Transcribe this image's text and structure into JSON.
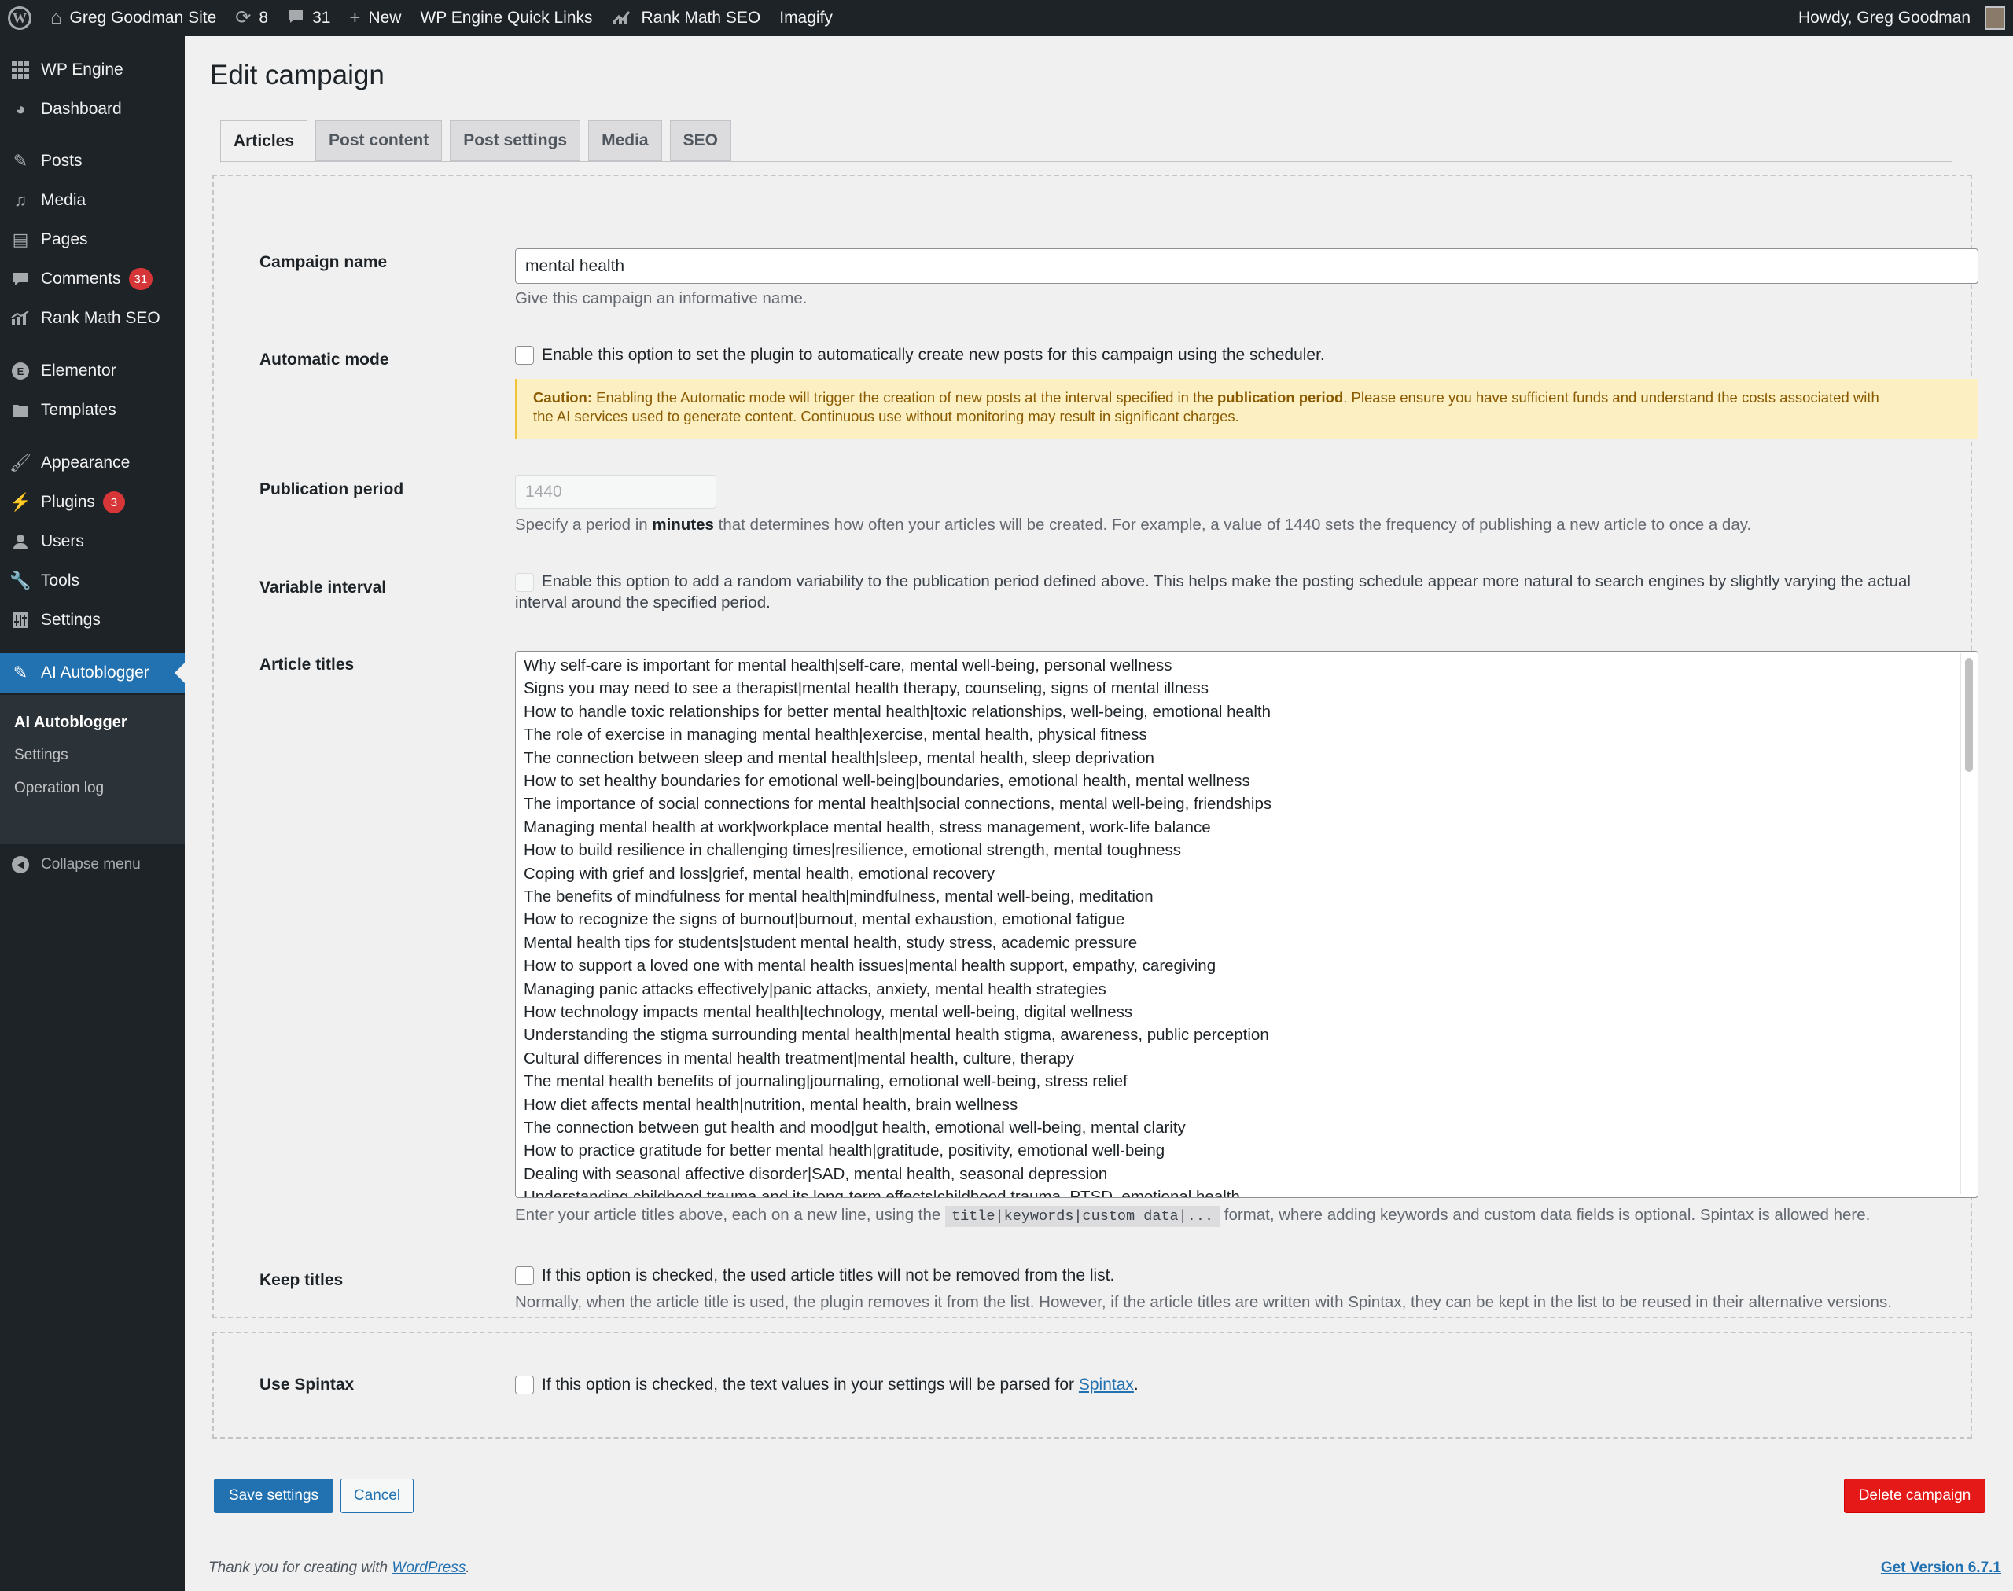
{
  "adminbar": {
    "site_name": "Greg Goodman Site",
    "updates_count": "8",
    "comments_count": "31",
    "new_label": "New",
    "quick_links_label": "WP Engine Quick Links",
    "rank_math_label": "Rank Math SEO",
    "imagify_label": "Imagify",
    "howdy": "Howdy, Greg Goodman"
  },
  "sidebar": {
    "items": [
      {
        "label": "WP Engine",
        "icon": "grid-icon"
      },
      {
        "label": "Dashboard",
        "icon": "dashboard-icon"
      },
      {
        "label": "Posts",
        "icon": "pin-icon"
      },
      {
        "label": "Media",
        "icon": "media-icon"
      },
      {
        "label": "Pages",
        "icon": "pages-icon"
      },
      {
        "label": "Comments",
        "icon": "comment-icon",
        "badge": "31"
      },
      {
        "label": "Rank Math SEO",
        "icon": "chart-icon"
      },
      {
        "label": "Elementor",
        "icon": "elementor-icon"
      },
      {
        "label": "Templates",
        "icon": "folder-icon"
      },
      {
        "label": "Appearance",
        "icon": "brush-icon"
      },
      {
        "label": "Plugins",
        "icon": "plug-icon",
        "badge": "3"
      },
      {
        "label": "Users",
        "icon": "user-icon"
      },
      {
        "label": "Tools",
        "icon": "wrench-icon"
      },
      {
        "label": "Settings",
        "icon": "settings-icon"
      },
      {
        "label": "AI Autoblogger",
        "icon": "pen-icon"
      }
    ],
    "submenu": [
      "AI Autoblogger",
      "Settings",
      "Operation log"
    ],
    "collapse_label": "Collapse menu"
  },
  "page": {
    "title": "Edit campaign",
    "tabs": [
      "Articles",
      "Post content",
      "Post settings",
      "Media",
      "SEO"
    ]
  },
  "form": {
    "campaign_name": {
      "label": "Campaign name",
      "value": "mental health",
      "description": "Give this campaign an informative name."
    },
    "automatic_mode": {
      "label": "Automatic mode",
      "checkbox_text": "Enable this option to set the plugin to automatically create new posts for this campaign using the scheduler.",
      "caution_label": "Caution:",
      "caution_text_1": "Enabling the Automatic mode will trigger the creation of new posts at the interval specified in the",
      "caution_strong": "publication period",
      "caution_text_2": ". Please ensure you have sufficient funds and understand the costs associated with",
      "caution_text_3": "the AI services used to generate content. Continuous use without monitoring may result in significant charges."
    },
    "publication_period": {
      "label": "Publication period",
      "value": "1440",
      "desc_1": "Specify a period in",
      "desc_strong": "minutes",
      "desc_2": "that determines how often your articles will be created. For example, a value of 1440 sets the frequency of publishing a new article to once a day."
    },
    "variable_interval": {
      "label": "Variable interval",
      "text_line_1": "Enable this option to add a random variability to the publication period defined above. This helps make the posting schedule appear more natural to search engines by slightly varying the actual",
      "text_line_2": "interval around the specified period."
    },
    "article_titles": {
      "label": "Article titles",
      "lines": [
        "Why self-care is important for mental health|self-care, mental well-being, personal wellness",
        "Signs you may need to see a therapist|mental health therapy, counseling, signs of mental illness",
        "How to handle toxic relationships for better mental health|toxic relationships, well-being, emotional health",
        "The role of exercise in managing mental health|exercise, mental health, physical fitness",
        "The connection between sleep and mental health|sleep, mental health, sleep deprivation",
        "How to set healthy boundaries for emotional well-being|boundaries, emotional health, mental wellness",
        "The importance of social connections for mental health|social connections, mental well-being, friendships",
        "Managing mental health at work|workplace mental health, stress management, work-life balance",
        "How to build resilience in challenging times|resilience, emotional strength, mental toughness",
        "Coping with grief and loss|grief, mental health, emotional recovery",
        "The benefits of mindfulness for mental health|mindfulness, mental well-being, meditation",
        "How to recognize the signs of burnout|burnout, mental exhaustion, emotional fatigue",
        "Mental health tips for students|student mental health, study stress, academic pressure",
        "How to support a loved one with mental health issues|mental health support, empathy, caregiving",
        "Managing panic attacks effectively|panic attacks, anxiety, mental health strategies",
        "How technology impacts mental health|technology, mental well-being, digital wellness",
        "Understanding the stigma surrounding mental health|mental health stigma, awareness, public perception",
        "Cultural differences in mental health treatment|mental health, culture, therapy",
        "The mental health benefits of journaling|journaling, emotional well-being, stress relief",
        "How diet affects mental health|nutrition, mental health, brain wellness",
        "The connection between gut health and mood|gut health, emotional well-being, mental clarity",
        "How to practice gratitude for better mental health|gratitude, positivity, emotional well-being",
        "Dealing with seasonal affective disorder|SAD, mental health, seasonal depression",
        "Understanding childhood trauma and its long-term effects|childhood trauma, PTSD, emotional health"
      ],
      "desc_1": "Enter your article titles above, each on a new line, using the",
      "desc_code": "title|keywords|custom data|...",
      "desc_2": "format, where adding keywords and custom data fields is optional. Spintax is allowed here."
    },
    "keep_titles": {
      "label": "Keep titles",
      "checkbox_text": "If this option is checked, the used article titles will not be removed from the list.",
      "description": "Normally, when the article title is used, the plugin removes it from the list. However, if the article titles are written with Spintax, they can be kept in the list to be reused in their alternative versions."
    },
    "use_spintax": {
      "label": "Use Spintax",
      "checkbox_text": "If this option is checked, the text values in your settings will be parsed for",
      "link_text": "Spintax",
      "period": "."
    }
  },
  "buttons": {
    "save": "Save settings",
    "cancel": "Cancel",
    "delete": "Delete campaign"
  },
  "footer": {
    "thanks_prefix": "Thank you for creating with",
    "wordpress_link": "WordPress",
    "thanks_suffix": ".",
    "version_link": "Get Version 6.7.1"
  },
  "colors": {
    "accent": "#2271b1",
    "danger": "#e61919",
    "caution_bg": "#fcf0c3"
  }
}
